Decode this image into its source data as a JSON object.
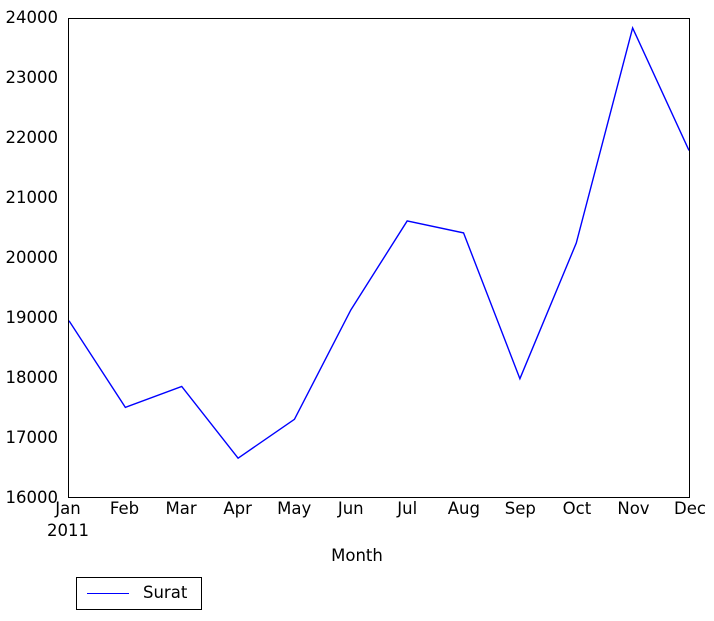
{
  "chart_data": {
    "type": "line",
    "title": "",
    "xlabel": "Month",
    "ylabel": "",
    "x_period_label": "2011",
    "categories": [
      "Jan",
      "Feb",
      "Mar",
      "Apr",
      "May",
      "Jun",
      "Jul",
      "Aug",
      "Sep",
      "Oct",
      "Nov",
      "Dec"
    ],
    "series": [
      {
        "name": "Surat",
        "color": "#0000ff",
        "values": [
          18950,
          17500,
          17850,
          16650,
          17300,
          19130,
          20620,
          20420,
          17980,
          20250,
          23850,
          21800
        ]
      }
    ],
    "ylim": [
      16000,
      24000
    ],
    "ytick_labels": [
      "16000",
      "17000",
      "18000",
      "19000",
      "20000",
      "21000",
      "22000",
      "23000",
      "24000"
    ],
    "ytick_values": [
      16000,
      17000,
      18000,
      19000,
      20000,
      21000,
      22000,
      23000,
      24000
    ],
    "grid": false,
    "legend_position": "below-left",
    "legend_entries": [
      "Surat"
    ]
  },
  "axes": {
    "x_axis_title": "Month",
    "year_label": "2011"
  },
  "legend": {
    "entry_label": "Surat"
  }
}
